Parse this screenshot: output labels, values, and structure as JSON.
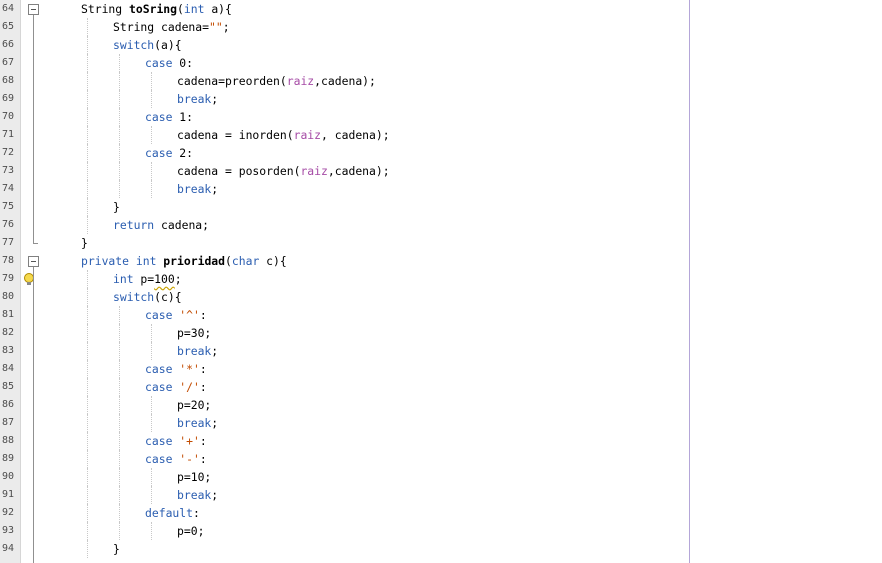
{
  "editor": {
    "lines": [
      {
        "n": "64",
        "indent": 0,
        "tokens": [
          [
            "t",
            "String "
          ],
          [
            "b",
            "toSring"
          ],
          [
            "t",
            "("
          ],
          [
            "k",
            "int"
          ],
          [
            "t",
            " a){"
          ]
        ]
      },
      {
        "n": "65",
        "indent": 1,
        "tokens": [
          [
            "t",
            "String cadena="
          ],
          [
            "s",
            "\"\""
          ],
          [
            "t",
            ";"
          ]
        ]
      },
      {
        "n": "66",
        "indent": 1,
        "tokens": [
          [
            "k",
            "switch"
          ],
          [
            "t",
            "(a){"
          ]
        ]
      },
      {
        "n": "67",
        "indent": 2,
        "tokens": [
          [
            "k",
            "case"
          ],
          [
            "t",
            " 0:"
          ]
        ]
      },
      {
        "n": "68",
        "indent": 3,
        "tokens": [
          [
            "t",
            "cadena=preorden("
          ],
          [
            "f",
            "raiz"
          ],
          [
            "t",
            ",cadena);"
          ]
        ]
      },
      {
        "n": "69",
        "indent": 3,
        "tokens": [
          [
            "k",
            "break"
          ],
          [
            "t",
            ";"
          ]
        ]
      },
      {
        "n": "70",
        "indent": 2,
        "tokens": [
          [
            "k",
            "case"
          ],
          [
            "t",
            " 1:"
          ]
        ]
      },
      {
        "n": "71",
        "indent": 3,
        "tokens": [
          [
            "t",
            "cadena = inorden("
          ],
          [
            "f",
            "raiz"
          ],
          [
            "t",
            ", cadena);"
          ]
        ]
      },
      {
        "n": "72",
        "indent": 2,
        "tokens": [
          [
            "k",
            "case"
          ],
          [
            "t",
            " 2:"
          ]
        ]
      },
      {
        "n": "73",
        "indent": 3,
        "tokens": [
          [
            "t",
            "cadena = posorden("
          ],
          [
            "f",
            "raiz"
          ],
          [
            "t",
            ",cadena);"
          ]
        ]
      },
      {
        "n": "74",
        "indent": 3,
        "tokens": [
          [
            "k",
            "break"
          ],
          [
            "t",
            ";"
          ]
        ]
      },
      {
        "n": "75",
        "indent": 1,
        "tokens": [
          [
            "t",
            "}"
          ]
        ]
      },
      {
        "n": "76",
        "indent": 1,
        "tokens": [
          [
            "k",
            "return"
          ],
          [
            "t",
            " cadena;"
          ]
        ]
      },
      {
        "n": "77",
        "indent": 0,
        "tokens": [
          [
            "t",
            "}"
          ]
        ]
      },
      {
        "n": "78",
        "indent": 0,
        "tokens": [
          [
            "k",
            "private int "
          ],
          [
            "b",
            "prioridad"
          ],
          [
            "t",
            "("
          ],
          [
            "k",
            "char"
          ],
          [
            "t",
            " c){"
          ]
        ]
      },
      {
        "n": "79",
        "indent": 1,
        "tokens": [
          [
            "k",
            "int"
          ],
          [
            "t",
            " p="
          ],
          [
            "w",
            "100"
          ],
          [
            "t",
            ";"
          ]
        ]
      },
      {
        "n": "80",
        "indent": 1,
        "tokens": [
          [
            "k",
            "switch"
          ],
          [
            "t",
            "(c){"
          ]
        ]
      },
      {
        "n": "81",
        "indent": 2,
        "tokens": [
          [
            "k",
            "case"
          ],
          [
            "t",
            " "
          ],
          [
            "s",
            "'^'"
          ],
          [
            "t",
            ":"
          ]
        ]
      },
      {
        "n": "82",
        "indent": 3,
        "tokens": [
          [
            "t",
            "p=30;"
          ]
        ]
      },
      {
        "n": "83",
        "indent": 3,
        "tokens": [
          [
            "k",
            "break"
          ],
          [
            "t",
            ";"
          ]
        ]
      },
      {
        "n": "84",
        "indent": 2,
        "tokens": [
          [
            "k",
            "case"
          ],
          [
            "t",
            " "
          ],
          [
            "s",
            "'*'"
          ],
          [
            "t",
            ":"
          ]
        ]
      },
      {
        "n": "85",
        "indent": 2,
        "tokens": [
          [
            "k",
            "case"
          ],
          [
            "t",
            " "
          ],
          [
            "s",
            "'/'"
          ],
          [
            "t",
            ":"
          ]
        ]
      },
      {
        "n": "86",
        "indent": 3,
        "tokens": [
          [
            "t",
            "p=20;"
          ]
        ]
      },
      {
        "n": "87",
        "indent": 3,
        "tokens": [
          [
            "k",
            "break"
          ],
          [
            "t",
            ";"
          ]
        ]
      },
      {
        "n": "88",
        "indent": 2,
        "tokens": [
          [
            "k",
            "case"
          ],
          [
            "t",
            " "
          ],
          [
            "s",
            "'+'"
          ],
          [
            "t",
            ":"
          ]
        ]
      },
      {
        "n": "89",
        "indent": 2,
        "tokens": [
          [
            "k",
            "case"
          ],
          [
            "t",
            " "
          ],
          [
            "s",
            "'-'"
          ],
          [
            "t",
            ":"
          ]
        ]
      },
      {
        "n": "90",
        "indent": 3,
        "tokens": [
          [
            "t",
            "p=10;"
          ]
        ]
      },
      {
        "n": "91",
        "indent": 3,
        "tokens": [
          [
            "k",
            "break"
          ],
          [
            "t",
            ";"
          ]
        ]
      },
      {
        "n": "92",
        "indent": 2,
        "tokens": [
          [
            "k",
            "default"
          ],
          [
            "t",
            ":"
          ]
        ]
      },
      {
        "n": "93",
        "indent": 3,
        "tokens": [
          [
            "t",
            "p=0;"
          ]
        ]
      },
      {
        "n": "94",
        "indent": 1,
        "tokens": [
          [
            "t",
            "}"
          ]
        ]
      }
    ],
    "hint_line": "79",
    "hint_icon": "warning-bulb-icon",
    "fold_lines": [
      "64",
      "78"
    ],
    "colors": {
      "keyword": "#2a5db0",
      "string": "#c24b00",
      "field": "#a64ca6",
      "text": "#000000",
      "gutter": "#ebebeb",
      "margin": "#b4a6d8"
    }
  }
}
